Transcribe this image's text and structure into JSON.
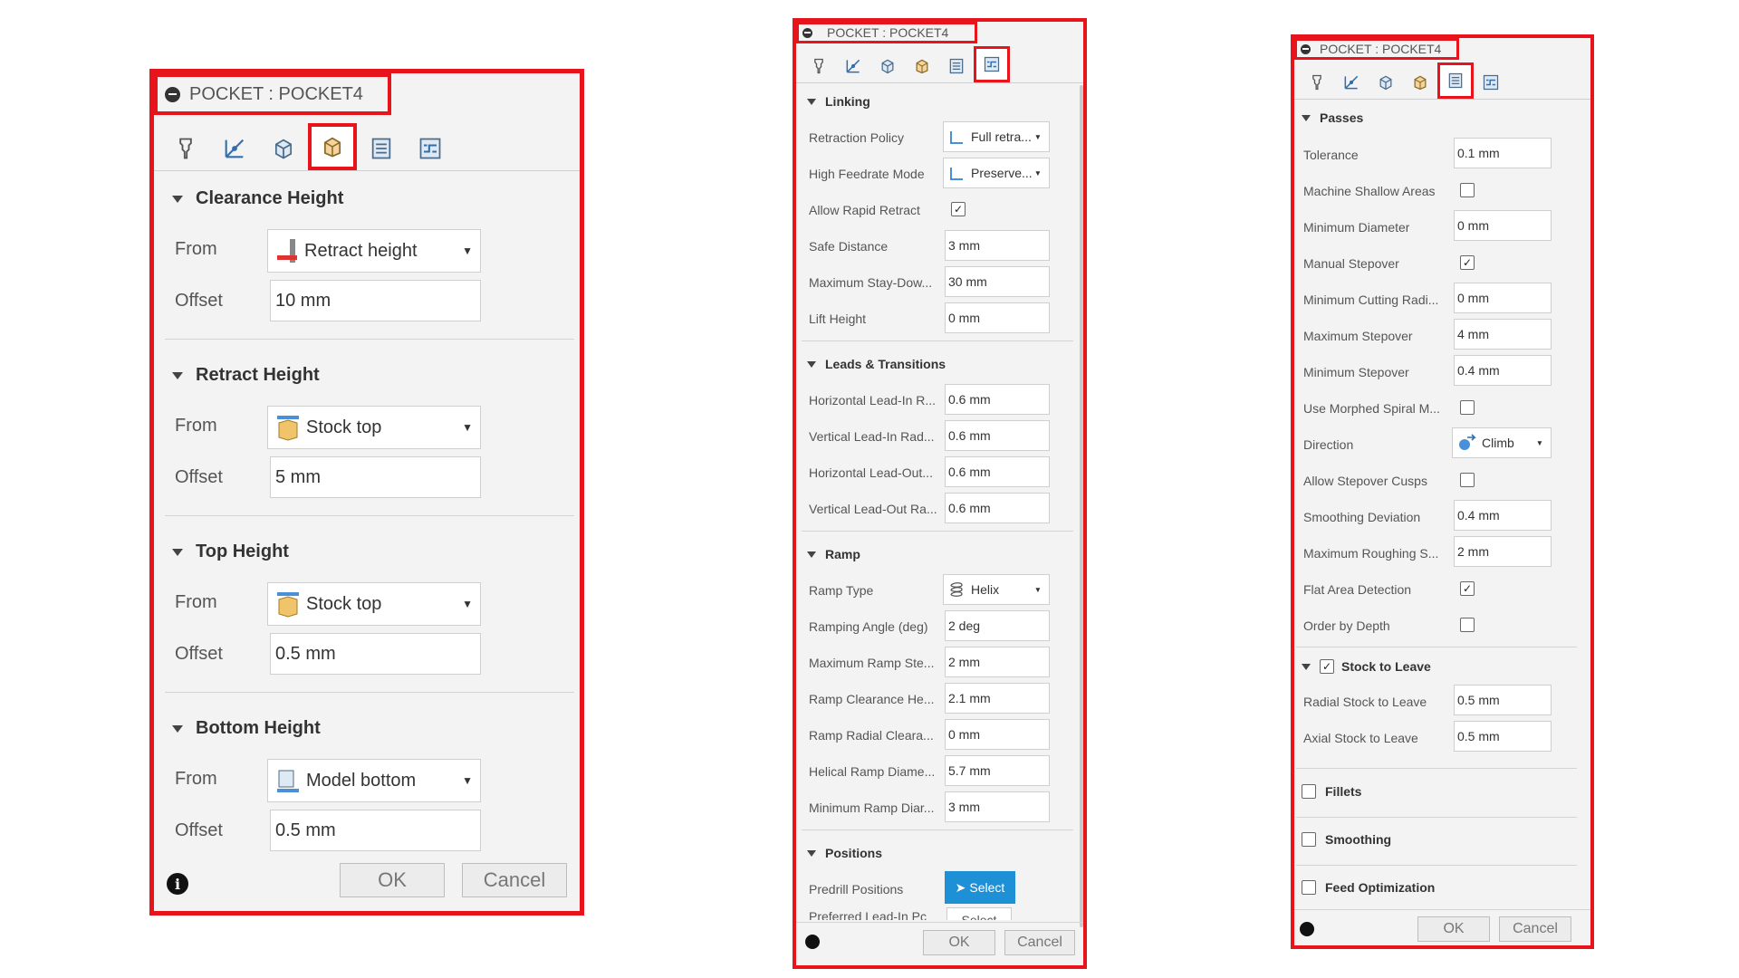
{
  "panel1": {
    "title": "POCKET : POCKET4",
    "sections": [
      {
        "title": "Clearance Height",
        "from_label": "From",
        "from_value": "Retract height",
        "offset_label": "Offset",
        "offset_value": "10 mm"
      },
      {
        "title": "Retract Height",
        "from_label": "From",
        "from_value": "Stock top",
        "offset_label": "Offset",
        "offset_value": "5 mm"
      },
      {
        "title": "Top Height",
        "from_label": "From",
        "from_value": "Stock top",
        "offset_label": "Offset",
        "offset_value": "0.5 mm"
      },
      {
        "title": "Bottom Height",
        "from_label": "From",
        "from_value": "Model bottom",
        "offset_label": "Offset",
        "offset_value": "0.5 mm"
      }
    ],
    "ok": "OK",
    "cancel": "Cancel"
  },
  "panel2": {
    "title": "POCKET : POCKET4",
    "linking": {
      "title": "Linking",
      "retraction_policy_label": "Retraction Policy",
      "retraction_policy_value": "Full retra...",
      "high_feedrate_label": "High Feedrate Mode",
      "high_feedrate_value": "Preserve...",
      "allow_rapid_label": "Allow Rapid Retract",
      "allow_rapid_checked": true,
      "safe_distance_label": "Safe Distance",
      "safe_distance_value": "3 mm",
      "max_stay_label": "Maximum Stay-Dow...",
      "max_stay_value": "30 mm",
      "lift_height_label": "Lift Height",
      "lift_height_value": "0 mm"
    },
    "leads": {
      "title": "Leads & Transitions",
      "rows": [
        {
          "label": "Horizontal Lead-In R...",
          "value": "0.6 mm"
        },
        {
          "label": "Vertical Lead-In Rad...",
          "value": "0.6 mm"
        },
        {
          "label": "Horizontal Lead-Out...",
          "value": "0.6 mm"
        },
        {
          "label": "Vertical Lead-Out Ra...",
          "value": "0.6 mm"
        }
      ]
    },
    "ramp": {
      "title": "Ramp",
      "type_label": "Ramp Type",
      "type_value": "Helix",
      "rows": [
        {
          "label": "Ramping Angle (deg)",
          "value": "2 deg"
        },
        {
          "label": "Maximum Ramp Ste...",
          "value": "2 mm"
        },
        {
          "label": "Ramp Clearance He...",
          "value": "2.1 mm"
        },
        {
          "label": "Ramp Radial Cleara...",
          "value": "0 mm"
        },
        {
          "label": "Helical Ramp Diame...",
          "value": "5.7 mm"
        },
        {
          "label": "Minimum Ramp Diar...",
          "value": "3 mm"
        }
      ]
    },
    "positions": {
      "title": "Positions",
      "predrill_label": "Predrill Positions",
      "predrill_button": "Select",
      "preferred_label": "Preferred Lead-In Pc",
      "preferred_button": "Select"
    },
    "ok": "OK",
    "cancel": "Cancel"
  },
  "panel3": {
    "title": "POCKET : POCKET4",
    "passes": {
      "title": "Passes",
      "tolerance_label": "Tolerance",
      "tolerance_value": "0.1 mm",
      "machine_shallow_label": "Machine Shallow Areas",
      "machine_shallow_checked": false,
      "min_diameter_label": "Minimum Diameter",
      "min_diameter_value": "0 mm",
      "manual_stepover_label": "Manual Stepover",
      "manual_stepover_checked": true,
      "min_cutting_label": "Minimum Cutting Radi...",
      "min_cutting_value": "0 mm",
      "max_stepover_label": "Maximum Stepover",
      "max_stepover_value": "4 mm",
      "min_stepover_label": "Minimum Stepover",
      "min_stepover_value": "0.4 mm",
      "morphed_label": "Use Morphed Spiral M...",
      "morphed_checked": false,
      "direction_label": "Direction",
      "direction_value": "Climb",
      "allow_cusps_label": "Allow Stepover Cusps",
      "allow_cusps_checked": false,
      "smoothing_dev_label": "Smoothing Deviation",
      "smoothing_dev_value": "0.4 mm",
      "max_roughing_label": "Maximum Roughing S...",
      "max_roughing_value": "2 mm",
      "flat_area_label": "Flat Area Detection",
      "flat_area_checked": true,
      "order_depth_label": "Order by Depth",
      "order_depth_checked": false
    },
    "stock": {
      "title": "Stock to Leave",
      "checked": true,
      "radial_label": "Radial Stock to Leave",
      "radial_value": "0.5 mm",
      "axial_label": "Axial Stock to Leave",
      "axial_value": "0.5 mm"
    },
    "fillets": {
      "title": "Fillets",
      "checked": false
    },
    "smoothing": {
      "title": "Smoothing",
      "checked": false
    },
    "feed_opt": {
      "title": "Feed Optimization",
      "checked": false
    },
    "ok": "OK",
    "cancel": "Cancel"
  },
  "colors": {
    "highlight": "#e8141c",
    "panel_bg": "#f3f3f3",
    "select_blue": "#1e90d6"
  }
}
